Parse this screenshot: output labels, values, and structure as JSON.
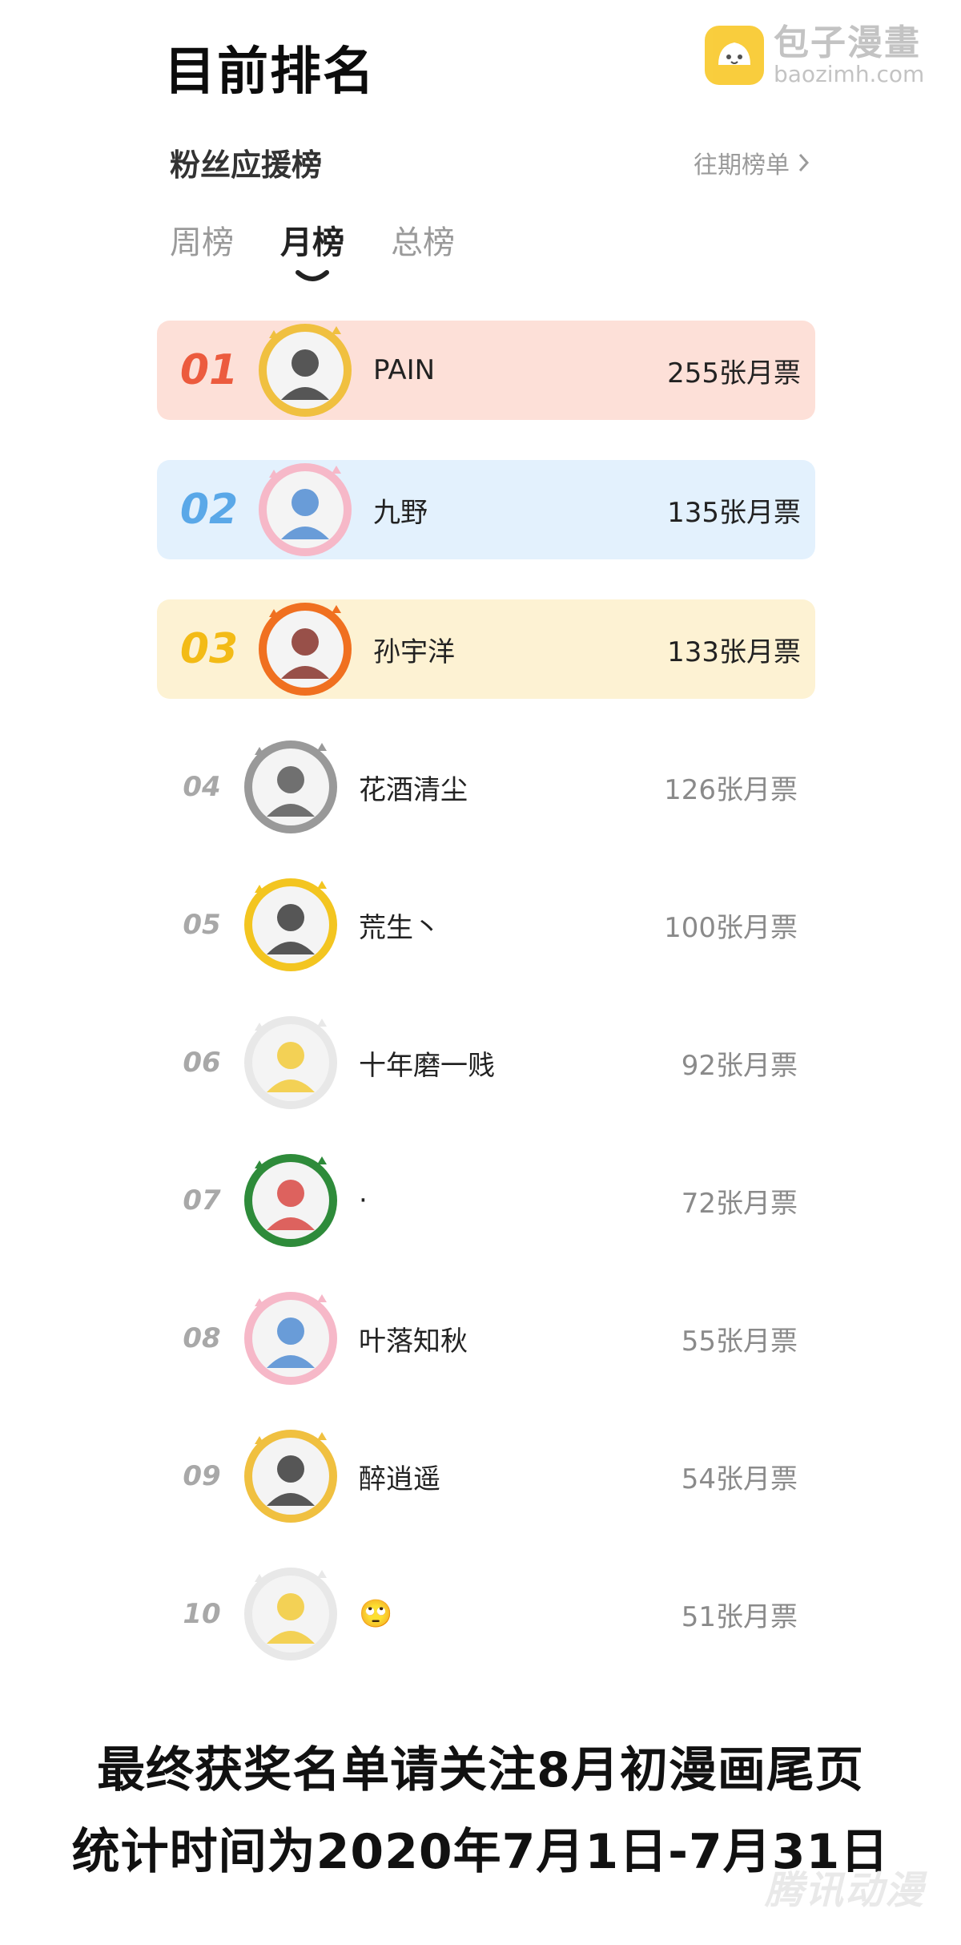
{
  "page_heading": "目前排名",
  "watermark": {
    "cn": "包子漫畫",
    "en": "baozimh.com"
  },
  "board": {
    "title": "粉丝应援榜",
    "history_link": "往期榜单"
  },
  "tabs": [
    {
      "label": "周榜",
      "active": false
    },
    {
      "label": "月榜",
      "active": true
    },
    {
      "label": "总榜",
      "active": false
    }
  ],
  "ranking": [
    {
      "rank": "01",
      "name": "PAIN",
      "votes": "255张月票",
      "rank_color": "#ec5b3e",
      "highlight": "#fde0d8",
      "frame": "fan-badge"
    },
    {
      "rank": "02",
      "name": "九野",
      "votes": "135张月票",
      "rank_color": "#5aa8e8",
      "highlight": "#e3f1fd",
      "frame": "sakura-penguin"
    },
    {
      "rank": "03",
      "name": "孙宇洋",
      "votes": "133张月票",
      "rank_color": "#f3bb16",
      "highlight": "#fdf2d3",
      "frame": "flame"
    },
    {
      "rank": "04",
      "name": "花酒清尘",
      "votes": "126张月票",
      "frame": "scythe"
    },
    {
      "rank": "05",
      "name": "荒生丶",
      "votes": "100张月票",
      "frame": "crown-cat"
    },
    {
      "rank": "06",
      "name": "十年磨一贱",
      "votes": "92张月票",
      "frame": "penguin-hood"
    },
    {
      "rank": "07",
      "name": "·",
      "votes": "72张月票",
      "frame": "wreath-2019"
    },
    {
      "rank": "08",
      "name": "叶落知秋",
      "votes": "55张月票",
      "frame": "sakura-penguin"
    },
    {
      "rank": "09",
      "name": "醉逍遥",
      "votes": "54张月票",
      "frame": "fan-badge"
    },
    {
      "rank": "10",
      "name": "🙄",
      "votes": "51张月票",
      "frame": "penguin-hood"
    }
  ],
  "footer": {
    "line1": "最终获奖名单请关注8月初漫画尾页",
    "line2": "统计时间为2020年7月1日-7月31日"
  },
  "corner_mark": "腾讯动漫"
}
